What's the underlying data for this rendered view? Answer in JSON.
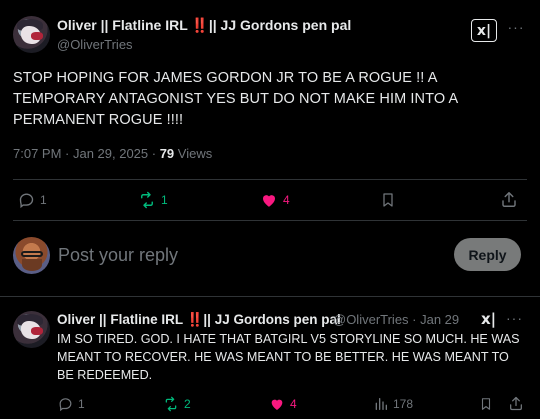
{
  "main_tweet": {
    "display_name_prefix": "Oliver || Flatline IRL ",
    "display_name_bang": "‼️",
    "display_name_suffix": "|| JJ Gordons pen pal",
    "handle": "@OliverTries",
    "text": "STOP HOPING FOR JAMES GORDON JR TO BE A ROGUE !! A TEMPORARY ANTAGONIST YES BUT DO NOT MAKE HIM INTO A PERMANENT ROGUE !!!!",
    "time": "7:07 PM · Jan 29, 2025 · ",
    "views_count": "79",
    "views_label": " Views",
    "actions": {
      "replies": "1",
      "reposts": "1",
      "likes": "4"
    },
    "grok_label": "x|",
    "more_label": "···"
  },
  "composer": {
    "placeholder": "Post your reply",
    "reply_button": "Reply"
  },
  "reply_tweet": {
    "display_name_prefix": "Oliver || Flatline IRL ",
    "display_name_bang": "‼️",
    "display_name_suffix": "|| JJ Gordons pen pal",
    "handle_date": "@OliverTries · Jan 29",
    "text": "IM SO TIRED. GOD. I HATE THAT BATGIRL V5 STORYLINE SO MUCH. HE WAS MEANT TO RECOVER. HE WAS MEANT TO BE BETTER. HE WAS MEANT TO BE REDEEMED.",
    "actions": {
      "replies": "1",
      "reposts": "2",
      "likes": "4",
      "views": "178"
    },
    "grok_label": "x|",
    "more_label": "···"
  },
  "colors": {
    "background": "#000000",
    "text": "#e7e9ea",
    "muted": "#71767b",
    "repost_green": "#00ba7c",
    "like_pink": "#f91880",
    "divider": "#2f3336"
  }
}
